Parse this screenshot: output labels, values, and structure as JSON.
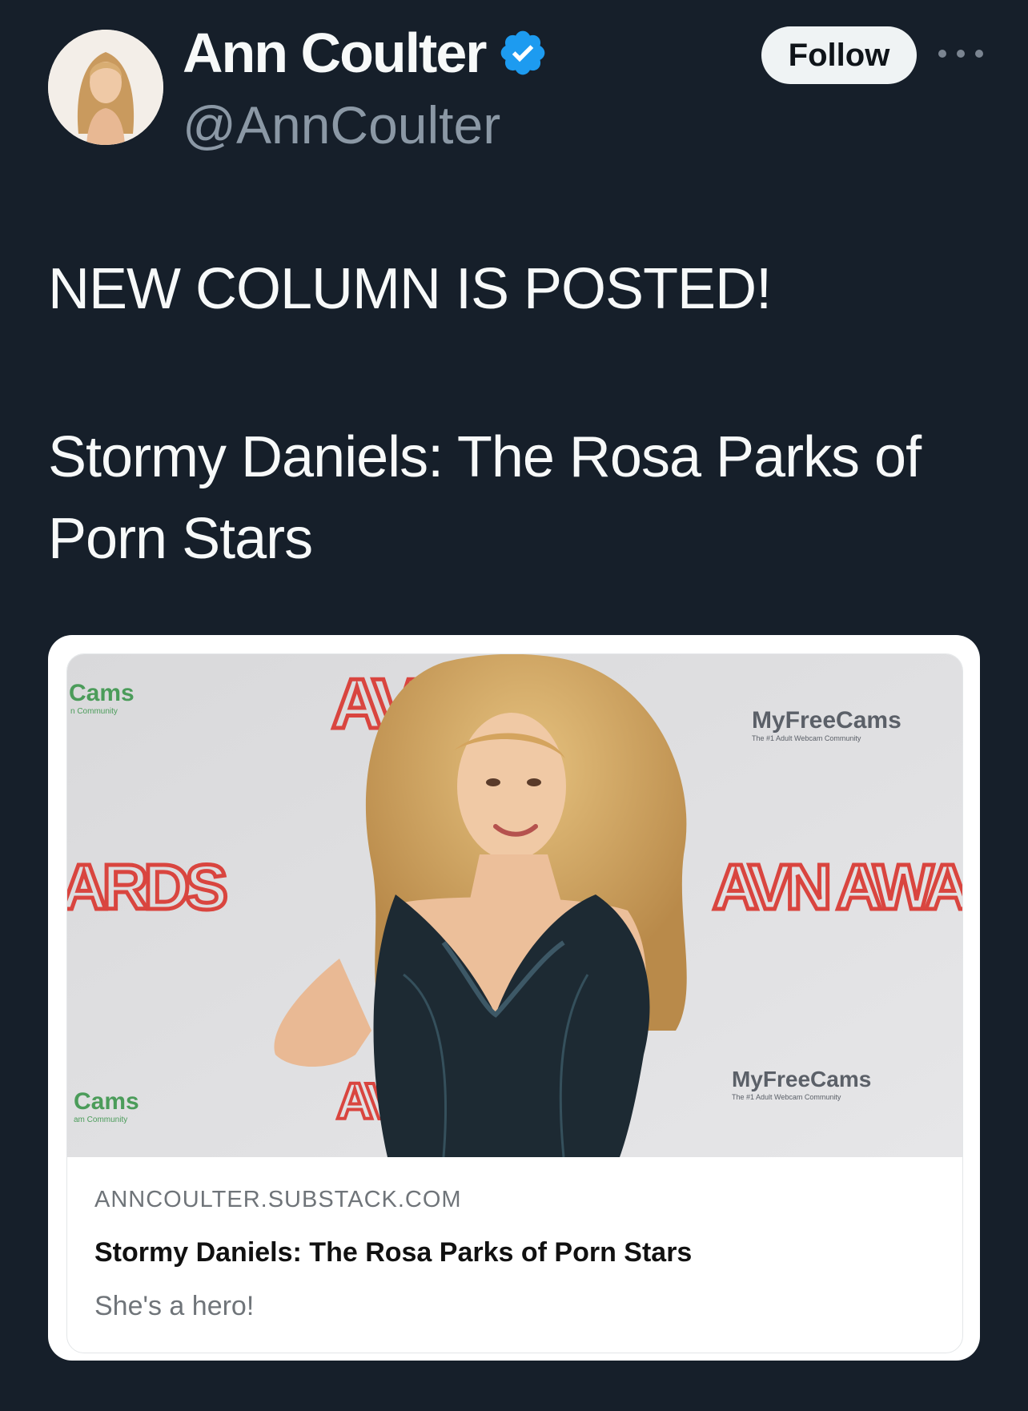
{
  "author": {
    "display_name": "Ann Coulter",
    "handle": "@AnnCoulter",
    "verified": true
  },
  "header": {
    "follow_label": "Follow"
  },
  "tweet": {
    "line1": "NEW COLUMN IS POSTED!",
    "line2": "Stormy Daniels: The Rosa Parks of Porn Stars"
  },
  "link_card": {
    "domain": "ANNCOULTER.SUBSTACK.COM",
    "title": "Stormy Daniels: The Rosa Parks of Porn Stars",
    "description": "She's a hero!",
    "backdrop_text": {
      "cams_left_top": "Cams",
      "cams_left_top_sub": "n Community",
      "avn_top": "AVN A",
      "myfreecams_top": "MyFreeCams",
      "myfreecams_top_sub": "The #1 Adult Webcam Community",
      "ards_left": "ARDS",
      "avn_awards_right": "AVN AWARDS",
      "myfreecams_bottom": "MyFreeCams",
      "myfreecams_bottom_sub": "The #1 Adult Webcam Community",
      "cams_left_bottom": "Cams",
      "cams_left_bottom_sub": "am Community",
      "avn_bottom": "AVN"
    }
  },
  "icons": {
    "verified": "verified-badge-icon",
    "more": "more-options-icon"
  },
  "colors": {
    "background": "#161f2a",
    "verified_blue": "#1d9bf0",
    "handle_gray": "#8b98a5",
    "avn_red": "#d9453f"
  }
}
